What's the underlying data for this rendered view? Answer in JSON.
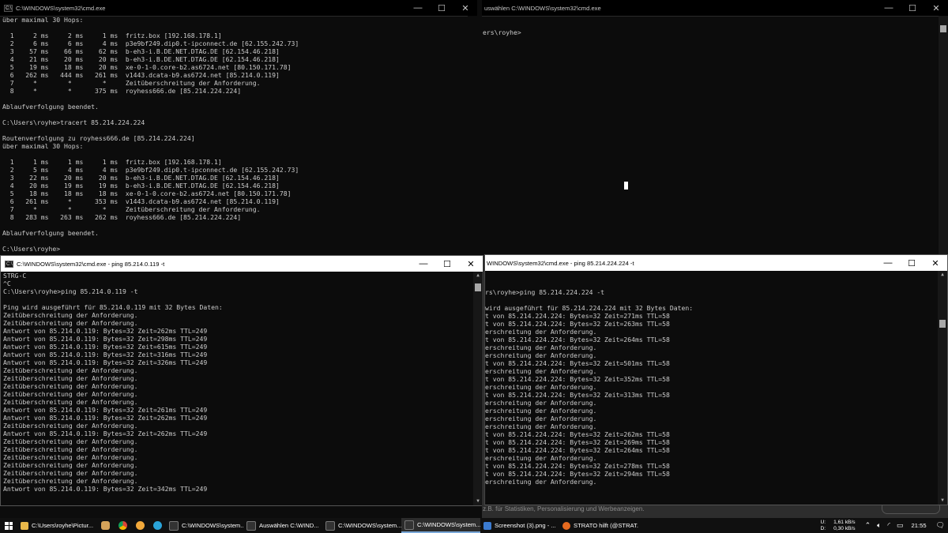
{
  "colors": {
    "console_bg": "#0c0c0c",
    "console_text": "#cccccc",
    "title_active": "#ffffff",
    "title_inactive": "#000000",
    "accent": "#7aa7d8"
  },
  "window_tl": {
    "title": "C:\\WINDOWS\\system32\\cmd.exe",
    "lines": [
      "über maximal 30 Hops:",
      "",
      "  1     2 ms     2 ms     1 ms  fritz.box [192.168.178.1]",
      "  2     6 ms     6 ms     4 ms  p3e9bf249.dip0.t-ipconnect.de [62.155.242.73]",
      "  3    57 ms    66 ms    62 ms  b-eh3-i.B.DE.NET.DTAG.DE [62.154.46.218]",
      "  4    21 ms    20 ms    20 ms  b-eh3-i.B.DE.NET.DTAG.DE [62.154.46.218]",
      "  5    19 ms    18 ms    20 ms  xe-0-1-0.core-b2.as6724.net [80.150.171.78]",
      "  6   262 ms   444 ms   261 ms  v1443.dcata-b9.as6724.net [85.214.0.119]",
      "  7     *        *        *     Zeitüberschreitung der Anforderung.",
      "  8     *        *      375 ms  royhess666.de [85.214.224.224]",
      "",
      "Ablaufverfolgung beendet.",
      "",
      "C:\\Users\\royhe>tracert 85.214.224.224",
      "",
      "Routenverfolgung zu royhess666.de [85.214.224.224]",
      "über maximal 30 Hops:",
      "",
      "  1     1 ms     1 ms     1 ms  fritz.box [192.168.178.1]",
      "  2     5 ms     4 ms     4 ms  p3e9bf249.dip0.t-ipconnect.de [62.155.242.73]",
      "  3    22 ms    20 ms    20 ms  b-eh3-i.B.DE.NET.DTAG.DE [62.154.46.218]",
      "  4    20 ms    19 ms    19 ms  b-eh3-i.B.DE.NET.DTAG.DE [62.154.46.218]",
      "  5    18 ms    18 ms    18 ms  xe-0-1-0.core-b2.as6724.net [80.150.171.78]",
      "  6   261 ms     *      353 ms  v1443.dcata-b9.as6724.net [85.214.0.119]",
      "  7     *        *        *     Zeitüberschreitung der Anforderung.",
      "  8   283 ms   263 ms   262 ms  royhess666.de [85.214.224.224]",
      "",
      "Ablaufverfolgung beendet.",
      "",
      "C:\\Users\\royhe>"
    ]
  },
  "window_tr": {
    "title": "uswählen C:\\WINDOWS\\system32\\cmd.exe",
    "lines": [
      "",
      "ers\\royhe>"
    ]
  },
  "window_bl": {
    "title": "C:\\WINDOWS\\system32\\cmd.exe - ping  85.214.0.119 -t",
    "lines": [
      "STRG-C",
      "^C",
      "C:\\Users\\royhe>ping 85.214.0.119 -t",
      "",
      "Ping wird ausgeführt für 85.214.0.119 mit 32 Bytes Daten:",
      "Zeitüberschreitung der Anforderung.",
      "Zeitüberschreitung der Anforderung.",
      "Antwort von 85.214.0.119: Bytes=32 Zeit=262ms TTL=249",
      "Antwort von 85.214.0.119: Bytes=32 Zeit=298ms TTL=249",
      "Antwort von 85.214.0.119: Bytes=32 Zeit=615ms TTL=249",
      "Antwort von 85.214.0.119: Bytes=32 Zeit=316ms TTL=249",
      "Antwort von 85.214.0.119: Bytes=32 Zeit=326ms TTL=249",
      "Zeitüberschreitung der Anforderung.",
      "Zeitüberschreitung der Anforderung.",
      "Zeitüberschreitung der Anforderung.",
      "Zeitüberschreitung der Anforderung.",
      "Zeitüberschreitung der Anforderung.",
      "Antwort von 85.214.0.119: Bytes=32 Zeit=261ms TTL=249",
      "Antwort von 85.214.0.119: Bytes=32 Zeit=262ms TTL=249",
      "Zeitüberschreitung der Anforderung.",
      "Antwort von 85.214.0.119: Bytes=32 Zeit=262ms TTL=249",
      "Zeitüberschreitung der Anforderung.",
      "Zeitüberschreitung der Anforderung.",
      "Zeitüberschreitung der Anforderung.",
      "Zeitüberschreitung der Anforderung.",
      "Zeitüberschreitung der Anforderung.",
      "Zeitüberschreitung der Anforderung.",
      "Antwort von 85.214.0.119: Bytes=32 Zeit=342ms TTL=249"
    ]
  },
  "window_br": {
    "title": "WINDOWS\\system32\\cmd.exe - ping  85.214.224.224 -t",
    "lines": [
      "",
      "",
      "rs\\royhe>ping 85.214.224.224 -t",
      "",
      "wird ausgeführt für 85.214.224.224 mit 32 Bytes Daten:",
      "t von 85.214.224.224: Bytes=32 Zeit=271ms TTL=58",
      "t von 85.214.224.224: Bytes=32 Zeit=263ms TTL=58",
      "erschreitung der Anforderung.",
      "t von 85.214.224.224: Bytes=32 Zeit=264ms TTL=58",
      "erschreitung der Anforderung.",
      "erschreitung der Anforderung.",
      "t von 85.214.224.224: Bytes=32 Zeit=501ms TTL=58",
      "erschreitung der Anforderung.",
      "t von 85.214.224.224: Bytes=32 Zeit=352ms TTL=58",
      "erschreitung der Anforderung.",
      "t von 85.214.224.224: Bytes=32 Zeit=313ms TTL=58",
      "erschreitung der Anforderung.",
      "erschreitung der Anforderung.",
      "erschreitung der Anforderung.",
      "erschreitung der Anforderung.",
      "t von 85.214.224.224: Bytes=32 Zeit=262ms TTL=58",
      "t von 85.214.224.224: Bytes=32 Zeit=269ms TTL=58",
      "t von 85.214.224.224: Bytes=32 Zeit=264ms TTL=58",
      "erschreitung der Anforderung.",
      "t von 85.214.224.224: Bytes=32 Zeit=278ms TTL=58",
      "t von 85.214.224.224: Bytes=32 Zeit=294ms TTL=58",
      "erschreitung der Anforderung."
    ]
  },
  "background_text": "Cookies z.B. für Statistiken, Personalisierung und Werbeanzeigen.",
  "taskbar": {
    "apps": [
      {
        "label": "C:\\Users\\royhe\\Pictur...",
        "icon": "folder-icon",
        "color": "#e8b84a"
      },
      {
        "label": "C:\\WINDOWS\\system...",
        "icon": "cmd-icon",
        "color": "#333333"
      },
      {
        "label": "Auswählen C:\\WIND...",
        "icon": "cmd-icon",
        "color": "#333333"
      },
      {
        "label": "C:\\WINDOWS\\system...",
        "icon": "cmd-icon",
        "color": "#333333"
      },
      {
        "label": "C:\\WINDOWS\\system...",
        "icon": "cmd-icon",
        "color": "#333333"
      },
      {
        "label": "Screenshot (3).png - ...",
        "icon": "photos-icon",
        "color": "#3b7bd0"
      },
      {
        "label": "STRATO hilft (@STRAT...",
        "icon": "firefox-icon",
        "color": "#e66a1f"
      }
    ],
    "net_labels": {
      "up": "U:",
      "down": "D:"
    },
    "net_values": {
      "up": "1,61 kB/s",
      "down": "0,30 kB/s"
    },
    "clock": "21:55"
  }
}
